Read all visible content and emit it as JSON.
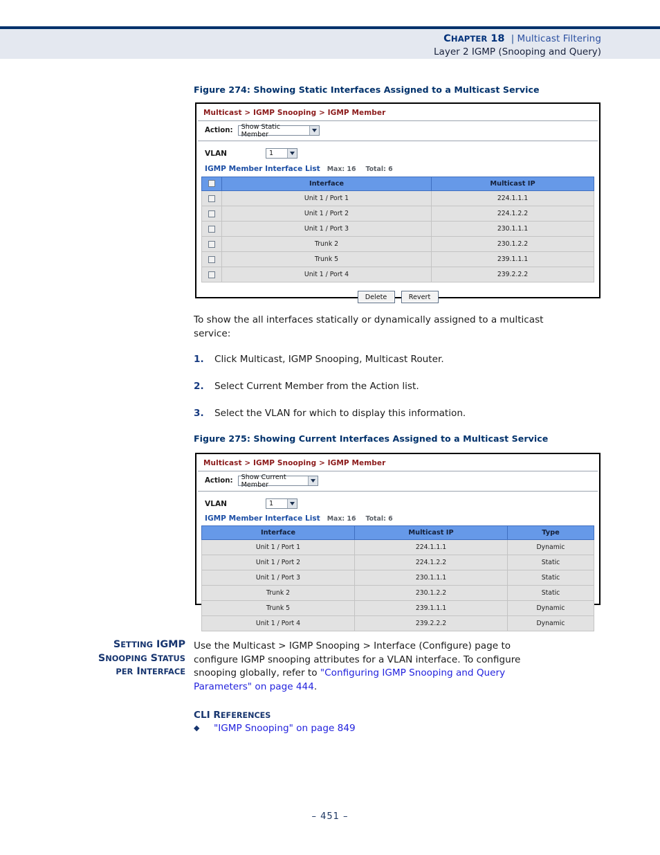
{
  "header": {
    "chapter_label": "Chapter 18",
    "chapter_word": "C",
    "separator": "|",
    "topic": "Multicast Filtering",
    "subtitle": "Layer 2 IGMP (Snooping and Query)"
  },
  "figure274": {
    "caption": "Figure 274:  Showing Static Interfaces Assigned to a Multicast Service",
    "breadcrumb": "Multicast > IGMP Snooping > IGMP Member",
    "action_label": "Action:",
    "action_value": "Show Static Member",
    "vlan_label": "VLAN",
    "vlan_value": "1",
    "list_title": "IGMP Member Interface List",
    "list_max": "Max: 16",
    "list_total": "Total: 6",
    "columns": [
      "Interface",
      "Multicast IP"
    ],
    "rows": [
      {
        "interface": "Unit 1 / Port 1",
        "multicast_ip": "224.1.1.1"
      },
      {
        "interface": "Unit 1 / Port 2",
        "multicast_ip": "224.1.2.2"
      },
      {
        "interface": "Unit 1 / Port 3",
        "multicast_ip": "230.1.1.1"
      },
      {
        "interface": "Trunk 2",
        "multicast_ip": "230.1.2.2"
      },
      {
        "interface": "Trunk 5",
        "multicast_ip": "239.1.1.1"
      },
      {
        "interface": "Unit 1 / Port 4",
        "multicast_ip": "239.2.2.2"
      }
    ],
    "delete_button": "Delete",
    "revert_button": "Revert"
  },
  "intro": {
    "line1": "To show the all interfaces statically or dynamically assigned to a multicast",
    "line2": "service:"
  },
  "steps": [
    {
      "num": "1.",
      "text": "Click Multicast, IGMP Snooping, Multicast Router."
    },
    {
      "num": "2.",
      "text": "Select Current Member from the Action list."
    },
    {
      "num": "3.",
      "text": "Select the VLAN for which to display this information."
    }
  ],
  "figure275": {
    "caption": "Figure 275:  Showing Current Interfaces Assigned to a Multicast Service",
    "breadcrumb": "Multicast > IGMP Snooping > IGMP Member",
    "action_label": "Action:",
    "action_value": "Show Current Member",
    "vlan_label": "VLAN",
    "vlan_value": "1",
    "list_title": "IGMP Member Interface List",
    "list_max": "Max: 16",
    "list_total": "Total: 6",
    "columns": [
      "Interface",
      "Multicast IP",
      "Type"
    ],
    "rows": [
      {
        "interface": "Unit 1 / Port 1",
        "multicast_ip": "224.1.1.1",
        "type": "Dynamic"
      },
      {
        "interface": "Unit 1 / Port 2",
        "multicast_ip": "224.1.2.2",
        "type": "Static"
      },
      {
        "interface": "Unit 1 / Port 3",
        "multicast_ip": "230.1.1.1",
        "type": "Static"
      },
      {
        "interface": "Trunk 2",
        "multicast_ip": "230.1.2.2",
        "type": "Static"
      },
      {
        "interface": "Trunk 5",
        "multicast_ip": "239.1.1.1",
        "type": "Dynamic"
      },
      {
        "interface": "Unit 1 / Port 4",
        "multicast_ip": "239.2.2.2",
        "type": "Dynamic"
      }
    ]
  },
  "section": {
    "margin_heading_line1": "Setting IGMP",
    "margin_heading_line2": "Snooping Status",
    "margin_heading_line3": "per Interface",
    "body_line1": "Use the Multicast > IGMP Snooping > Interface (Configure) page to",
    "body_line2": "configure IGMP snooping attributes for a VLAN interface. To configure",
    "body_line3_pre": "snooping globally, refer to ",
    "body_link_part1": "\"Configuring IGMP Snooping and Query",
    "body_link_part2": "Parameters\" on page 444",
    "body_line4_post": ".",
    "cli_references_heading": "CLI References",
    "cli_reference_item": "\"IGMP Snooping\" on page 849"
  },
  "footer": {
    "page_number": "–  451  –"
  }
}
